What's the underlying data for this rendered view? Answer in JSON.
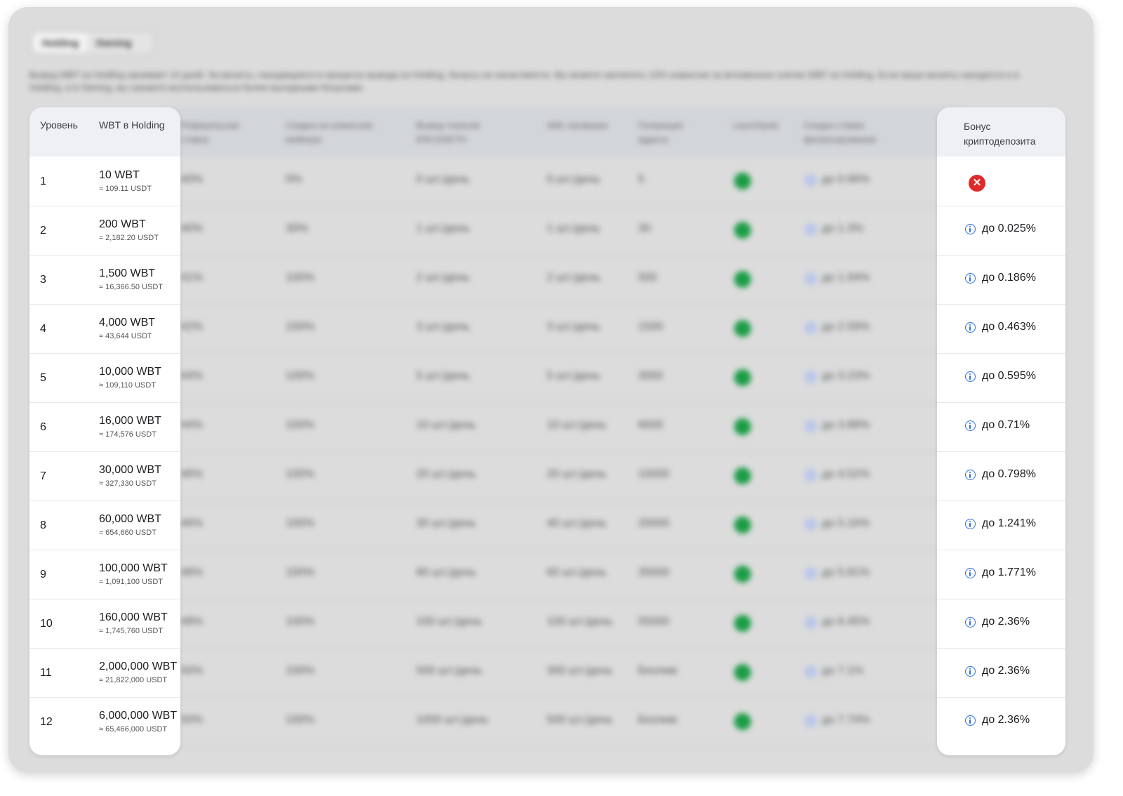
{
  "tabs": [
    "Holding",
    "Owning"
  ],
  "notice": "Вывод WBT из Holding занимает 14 дней. За монеты, находящиеся в процессе вывода из Holding, бонусы не начисляются. Вы можете заплатить 10% комиссии за мгновенное снятие WBT из Holding. Если ваши монеты находятся и в Holding, и в Owning, вы сможете воспользоваться более выгодными бонусами.",
  "headers": {
    "level": "Уровень",
    "wbt_holding": "WBT в Holding",
    "referral": "Реферальная ставка",
    "maker_discount": "Скидка на комиссию мейкера",
    "withdraw": "Вывод токенов ERC20/ETH",
    "aml": "AML-проверки",
    "address": "Генерация адреса",
    "launchpad": "Launchpad",
    "funding": "Скидка ставки финансирования",
    "crypto_bonus": "Бонус криптодепозита"
  },
  "rows": [
    {
      "level": "1",
      "wbt": "10 WBT",
      "usdt": "≈ 109.11 USDT",
      "referral": "40%",
      "maker": "0%",
      "withdraw": "0 шт./день",
      "aml": "0 шт./день",
      "address": "5",
      "funding": "до 0.66%",
      "bonus": ""
    },
    {
      "level": "2",
      "wbt": "200 WBT",
      "usdt": "≈ 2,182.20 USDT",
      "referral": "40%",
      "maker": "30%",
      "withdraw": "1 шт./день",
      "aml": "1 шт./день",
      "address": "30",
      "funding": "до 1.3%",
      "bonus": "до 0.025%"
    },
    {
      "level": "3",
      "wbt": "1,500 WBT",
      "usdt": "≈ 16,366.50 USDT",
      "referral": "41%",
      "maker": "100%",
      "withdraw": "2 шт./день",
      "aml": "2 шт./день",
      "address": "500",
      "funding": "до 1.94%",
      "bonus": "до 0.186%"
    },
    {
      "level": "4",
      "wbt": "4,000 WBT",
      "usdt": "≈ 43,644 USDT",
      "referral": "42%",
      "maker": "100%",
      "withdraw": "3 шт./день",
      "aml": "3 шт./день",
      "address": "1500",
      "funding": "до 2.59%",
      "bonus": "до 0.463%"
    },
    {
      "level": "5",
      "wbt": "10,000 WBT",
      "usdt": "≈ 109,110 USDT",
      "referral": "44%",
      "maker": "100%",
      "withdraw": "5 шт./день",
      "aml": "5 шт./день",
      "address": "3000",
      "funding": "до 3.23%",
      "bonus": "до 0.595%"
    },
    {
      "level": "6",
      "wbt": "16,000 WBT",
      "usdt": "≈ 174,576 USDT",
      "referral": "44%",
      "maker": "100%",
      "withdraw": "10 шт./день",
      "aml": "10 шт./день",
      "address": "6000",
      "funding": "до 3.88%",
      "bonus": "до 0.71%"
    },
    {
      "level": "7",
      "wbt": "30,000 WBT",
      "usdt": "≈ 327,330 USDT",
      "referral": "46%",
      "maker": "100%",
      "withdraw": "20 шт./день",
      "aml": "20 шт./день",
      "address": "10000",
      "funding": "до 4.52%",
      "bonus": "до 0.798%"
    },
    {
      "level": "8",
      "wbt": "60,000 WBT",
      "usdt": "≈ 654,660 USDT",
      "referral": "46%",
      "maker": "100%",
      "withdraw": "30 шт./день",
      "aml": "40 шт./день",
      "address": "20000",
      "funding": "до 5.16%",
      "bonus": "до 1.241%"
    },
    {
      "level": "9",
      "wbt": "100,000 WBT",
      "usdt": "≈ 1,091,100 USDT",
      "referral": "48%",
      "maker": "100%",
      "withdraw": "80 шт./день",
      "aml": "60 шт./день",
      "address": "35000",
      "funding": "до 5.81%",
      "bonus": "до 1.771%"
    },
    {
      "level": "10",
      "wbt": "160,000 WBT",
      "usdt": "≈ 1,745,760 USDT",
      "referral": "48%",
      "maker": "100%",
      "withdraw": "100 шт./день",
      "aml": "100 шт./день",
      "address": "55000",
      "funding": "до 6.45%",
      "bonus": "до 2.36%"
    },
    {
      "level": "11",
      "wbt": "2,000,000 WBT",
      "usdt": "≈ 21,822,000 USDT",
      "referral": "50%",
      "maker": "100%",
      "withdraw": "500 шт./день",
      "aml": "300 шт./день",
      "address": "Безлим",
      "funding": "до 7.1%",
      "bonus": "до 2.36%"
    },
    {
      "level": "12",
      "wbt": "6,000,000 WBT",
      "usdt": "≈ 65,466,000 USDT",
      "referral": "50%",
      "maker": "100%",
      "withdraw": "1000 шт./день",
      "aml": "500 шт./день",
      "address": "Безлим",
      "funding": "до 7.74%",
      "bonus": "до 2.36%"
    }
  ],
  "colors": {
    "frame_bg": "#dcdcdc",
    "check": "#1a9c45",
    "info": "#2f6fde",
    "error": "#e02a2a"
  }
}
